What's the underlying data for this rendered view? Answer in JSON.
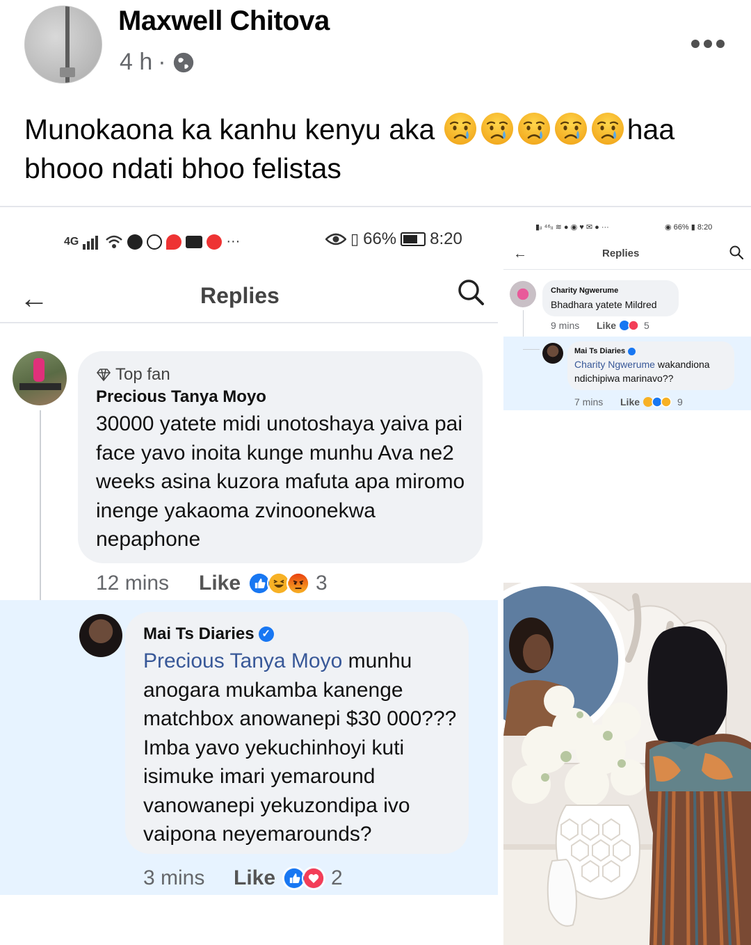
{
  "post": {
    "author": "Maxwell Chitova",
    "time": "4 h",
    "separator": "·",
    "privacy_icon": "globe-icon",
    "more_icon": "more-dots-icon",
    "text_part1": "Munokaona ka kanhu kenyu aka ",
    "emoji": "crying-face-emoji",
    "emoji_count": 5,
    "text_part2": "haa bhooo ndati bhoo felistas"
  },
  "left_screenshot": {
    "status_left": "4G",
    "battery": "66%",
    "clock": "8:20",
    "header_title": "Replies",
    "comment": {
      "badge": "Top fan",
      "author": "Precious Tanya Moyo",
      "body": "30000 yatete midi unotoshaya yaiva pai face yavo inoita kunge munhu Ava ne2 weeks asina kuzora mafuta apa miromo inenge yakaoma zvinoonekwa nepaphone",
      "time": "12 mins",
      "like_label": "Like",
      "reaction_count": "3",
      "reactions": [
        "like",
        "haha",
        "angry"
      ]
    },
    "reply": {
      "author": "Mai Ts Diaries",
      "mention": "Precious Tanya Moyo",
      "body": " munhu anogara mukamba kanenge matchbox anowanepi $30 000??? Imba yavo yekuchinhoyi kuti isimuke imari yemaround vanowanepi yekuzondipa ivo vaipona neyemarounds?",
      "time": "3 mins",
      "like_label": "Like",
      "reaction_count": "2",
      "reactions": [
        "like",
        "love"
      ]
    }
  },
  "right_screenshot": {
    "battery": "66%",
    "clock": "8:20",
    "header_title": "Replies",
    "comment": {
      "author": "Charity Ngwerume",
      "body": "Bhadhara yatete Mildred",
      "time": "9 mins",
      "like_label": "Like",
      "reaction_count": "5"
    },
    "reply": {
      "author": "Mai Ts Diaries",
      "mention": "Charity Ngwerume",
      "body": " wakandiona ndichipiwa marinavo??",
      "time": "7 mins",
      "like_label": "Like",
      "reaction_count": "9"
    }
  },
  "colors": {
    "facebook_blue": "#1877f2",
    "reply_highlight": "#e7f3ff",
    "bubble": "#f0f2f5",
    "mention": "#385898"
  }
}
